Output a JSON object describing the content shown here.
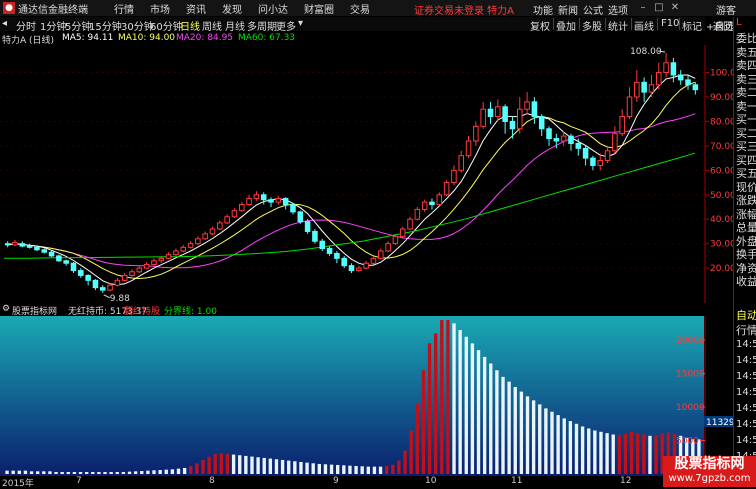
{
  "titlebar": {
    "app_name": "通达信金融终端",
    "menus": [
      "行情",
      "市场",
      "资讯",
      "发现",
      "问小达",
      "财富圈",
      "交易"
    ],
    "warning": "证券交易未登录 特力A",
    "right_menus": [
      "功能",
      "新闻",
      "公式",
      "选项"
    ],
    "guest": "游客"
  },
  "toolbar": {
    "periods": [
      "分时",
      "1分钟",
      "5分钟",
      "15分钟",
      "30分钟",
      "60分钟",
      "日线",
      "周线",
      "月线",
      "多周期",
      "更多"
    ],
    "active_period": "日线",
    "right_tools": [
      "复权",
      "叠加",
      "多股",
      "统计",
      "画线",
      "F10",
      "标记",
      "+自选",
      "返回"
    ]
  },
  "infobar": {
    "stock": "特力A (日线)",
    "ma5": "MA5: 94.11",
    "ma10": "MA10: 94.00",
    "ma20": "MA20: 84.95",
    "ma60": "MA60: 67.33"
  },
  "colors": {
    "ma5": "#ffffff",
    "ma10": "#ffff54",
    "ma20": "#ff40ff",
    "ma60": "#00e000",
    "up": "#ff3b3b",
    "down": "#54ffff",
    "accent": "#ffff54"
  },
  "price_axis": {
    "labels": [
      "100.00",
      "90.00",
      "80.00",
      "70.00",
      "60.00",
      "50.00",
      "40.00",
      "30.00",
      "20.00"
    ],
    "values": [
      100,
      90,
      80,
      70,
      60,
      50,
      40,
      30,
      20
    ],
    "min": 9,
    "max": 108
  },
  "annotations": {
    "high": "108.00",
    "low": "9.88",
    "corner_l": "L"
  },
  "right_panel": {
    "items": [
      "委比",
      "卖五",
      "卖四",
      "卖三",
      "卖二",
      "卖一",
      "买一",
      "买二",
      "买三",
      "买四",
      "买五",
      "现价",
      "涨跌",
      "涨幅",
      "总量",
      "外盘",
      "换手",
      "净资",
      "收益"
    ],
    "lower_items": [
      "自动",
      "行情"
    ],
    "times": [
      "14:50",
      "14:50",
      "14:50",
      "14:50",
      "14:50",
      "14:50",
      "14:50",
      "14:50"
    ]
  },
  "indicator": {
    "title": "股票指标网",
    "label": "无红持币: 5173.37",
    "label2": "翻红持股",
    "label3": "分界线: 1.00",
    "axis_labels": [
      "20000",
      "15000",
      "10000",
      "5000"
    ],
    "axis_values": [
      20000,
      15000,
      10000,
      5000
    ],
    "current": "11329.5",
    "max": 23000
  },
  "dates": {
    "labels": [
      "2015年",
      "7",
      "8",
      "9",
      "10",
      "11",
      "12"
    ]
  },
  "watermark": {
    "line1": "股票指标网",
    "line2": "www.7gpzb.com"
  },
  "chart_data": {
    "type": "candlestick",
    "x_labels": [
      "2015年",
      "7",
      "8",
      "9",
      "10",
      "11",
      "12"
    ],
    "ylim": [
      9,
      108
    ],
    "candles": [
      {
        "o": 30,
        "c": 29.5,
        "h": 31,
        "l": 28.5
      },
      {
        "o": 29.5,
        "c": 30.5,
        "h": 31.5,
        "l": 29
      },
      {
        "o": 30,
        "c": 29,
        "h": 31,
        "l": 28.5
      },
      {
        "o": 29,
        "c": 28.5,
        "h": 30,
        "l": 28
      },
      {
        "o": 28.5,
        "c": 27.5,
        "h": 29,
        "l": 27
      },
      {
        "o": 27.5,
        "c": 26.5,
        "h": 28,
        "l": 26
      },
      {
        "o": 26.5,
        "c": 25,
        "h": 27,
        "l": 24.5
      },
      {
        "o": 25,
        "c": 23,
        "h": 25.5,
        "l": 22.5
      },
      {
        "o": 23,
        "c": 22,
        "h": 23.5,
        "l": 21
      },
      {
        "o": 22,
        "c": 19,
        "h": 22.5,
        "l": 18
      },
      {
        "o": 19,
        "c": 17,
        "h": 20,
        "l": 16
      },
      {
        "o": 17,
        "c": 15,
        "h": 17.5,
        "l": 13
      },
      {
        "o": 15,
        "c": 12,
        "h": 15.5,
        "l": 11
      },
      {
        "o": 12,
        "c": 11,
        "h": 13,
        "l": 9.88
      },
      {
        "o": 11,
        "c": 13,
        "h": 14,
        "l": 10.5
      },
      {
        "o": 13,
        "c": 15,
        "h": 16,
        "l": 12.5
      },
      {
        "o": 15,
        "c": 17,
        "h": 18,
        "l": 14.5
      },
      {
        "o": 17,
        "c": 18.5,
        "h": 19.5,
        "l": 16.5
      },
      {
        "o": 18.5,
        "c": 20,
        "h": 21,
        "l": 18
      },
      {
        "o": 20,
        "c": 21.5,
        "h": 22.5,
        "l": 19.5
      },
      {
        "o": 21.5,
        "c": 23,
        "h": 24,
        "l": 21
      },
      {
        "o": 23,
        "c": 24,
        "h": 25,
        "l": 22
      },
      {
        "o": 24,
        "c": 25.5,
        "h": 26.5,
        "l": 23.5
      },
      {
        "o": 25.5,
        "c": 27,
        "h": 28,
        "l": 25
      },
      {
        "o": 27,
        "c": 28.5,
        "h": 29.5,
        "l": 26.5
      },
      {
        "o": 28.5,
        "c": 30,
        "h": 31,
        "l": 28
      },
      {
        "o": 30,
        "c": 32,
        "h": 33,
        "l": 29.5
      },
      {
        "o": 32,
        "c": 34,
        "h": 35,
        "l": 31.5
      },
      {
        "o": 34,
        "c": 36,
        "h": 37,
        "l": 33.5
      },
      {
        "o": 36,
        "c": 38.5,
        "h": 39.5,
        "l": 35.5
      },
      {
        "o": 38.5,
        "c": 41,
        "h": 42,
        "l": 38
      },
      {
        "o": 41,
        "c": 43.5,
        "h": 44.5,
        "l": 40.5
      },
      {
        "o": 43.5,
        "c": 46,
        "h": 47,
        "l": 43
      },
      {
        "o": 46,
        "c": 48.5,
        "h": 50,
        "l": 45.5
      },
      {
        "o": 48.5,
        "c": 50,
        "h": 51.5,
        "l": 47.5
      },
      {
        "o": 50,
        "c": 48,
        "h": 51,
        "l": 46
      },
      {
        "o": 48,
        "c": 47,
        "h": 49,
        "l": 45
      },
      {
        "o": 47,
        "c": 48.5,
        "h": 49.5,
        "l": 46
      },
      {
        "o": 48.5,
        "c": 46,
        "h": 49,
        "l": 44
      },
      {
        "o": 46,
        "c": 43,
        "h": 46.5,
        "l": 42
      },
      {
        "o": 43,
        "c": 39,
        "h": 43.5,
        "l": 38
      },
      {
        "o": 39,
        "c": 35,
        "h": 40,
        "l": 34
      },
      {
        "o": 35,
        "c": 31,
        "h": 36,
        "l": 30
      },
      {
        "o": 31,
        "c": 28,
        "h": 32,
        "l": 27
      },
      {
        "o": 28,
        "c": 26,
        "h": 29,
        "l": 25
      },
      {
        "o": 26,
        "c": 24,
        "h": 27,
        "l": 22
      },
      {
        "o": 24,
        "c": 21,
        "h": 25,
        "l": 20
      },
      {
        "o": 21,
        "c": 19,
        "h": 22,
        "l": 18
      },
      {
        "o": 19,
        "c": 20,
        "h": 21,
        "l": 18.5
      },
      {
        "o": 20,
        "c": 22,
        "h": 23,
        "l": 19.5
      },
      {
        "o": 22,
        "c": 24,
        "h": 25,
        "l": 21.5
      },
      {
        "o": 24,
        "c": 27,
        "h": 28,
        "l": 23.5
      },
      {
        "o": 27,
        "c": 30,
        "h": 31,
        "l": 26.5
      },
      {
        "o": 30,
        "c": 33,
        "h": 34,
        "l": 29.5
      },
      {
        "o": 33,
        "c": 36,
        "h": 37,
        "l": 32.5
      },
      {
        "o": 36,
        "c": 40,
        "h": 41,
        "l": 35.5
      },
      {
        "o": 40,
        "c": 44,
        "h": 45,
        "l": 39.5
      },
      {
        "o": 44,
        "c": 47,
        "h": 48,
        "l": 43
      },
      {
        "o": 47,
        "c": 46,
        "h": 48.5,
        "l": 44
      },
      {
        "o": 46,
        "c": 50,
        "h": 51,
        "l": 45.5
      },
      {
        "o": 50,
        "c": 55,
        "h": 56,
        "l": 49.5
      },
      {
        "o": 55,
        "c": 60,
        "h": 62,
        "l": 54
      },
      {
        "o": 60,
        "c": 66,
        "h": 68,
        "l": 59
      },
      {
        "o": 66,
        "c": 72,
        "h": 74,
        "l": 65
      },
      {
        "o": 72,
        "c": 78,
        "h": 80,
        "l": 70
      },
      {
        "o": 78,
        "c": 85,
        "h": 88,
        "l": 77
      },
      {
        "o": 85,
        "c": 82,
        "h": 88,
        "l": 79
      },
      {
        "o": 82,
        "c": 86,
        "h": 89,
        "l": 80
      },
      {
        "o": 86,
        "c": 80,
        "h": 87,
        "l": 75
      },
      {
        "o": 80,
        "c": 77,
        "h": 82,
        "l": 73
      },
      {
        "o": 77,
        "c": 85,
        "h": 90,
        "l": 75
      },
      {
        "o": 85,
        "c": 88,
        "h": 92,
        "l": 83
      },
      {
        "o": 88,
        "c": 82,
        "h": 90,
        "l": 79
      },
      {
        "o": 82,
        "c": 77,
        "h": 83,
        "l": 74
      },
      {
        "o": 77,
        "c": 73,
        "h": 78,
        "l": 70
      },
      {
        "o": 73,
        "c": 72,
        "h": 75,
        "l": 69
      },
      {
        "o": 72,
        "c": 74,
        "h": 76,
        "l": 70
      },
      {
        "o": 74,
        "c": 71,
        "h": 75,
        "l": 68
      },
      {
        "o": 71,
        "c": 69,
        "h": 73,
        "l": 66
      },
      {
        "o": 69,
        "c": 65,
        "h": 70,
        "l": 62
      },
      {
        "o": 65,
        "c": 62,
        "h": 66,
        "l": 60
      },
      {
        "o": 62,
        "c": 64,
        "h": 67,
        "l": 60
      },
      {
        "o": 64,
        "c": 68,
        "h": 70,
        "l": 63
      },
      {
        "o": 68,
        "c": 75,
        "h": 78,
        "l": 67
      },
      {
        "o": 75,
        "c": 82,
        "h": 85,
        "l": 74
      },
      {
        "o": 82,
        "c": 90,
        "h": 94,
        "l": 81
      },
      {
        "o": 90,
        "c": 96,
        "h": 101,
        "l": 88
      },
      {
        "o": 96,
        "c": 92,
        "h": 98,
        "l": 88
      },
      {
        "o": 92,
        "c": 95,
        "h": 99,
        "l": 90
      },
      {
        "o": 95,
        "c": 100,
        "h": 104,
        "l": 93
      },
      {
        "o": 100,
        "c": 104,
        "h": 108,
        "l": 98
      },
      {
        "o": 104,
        "c": 99,
        "h": 106,
        "l": 96
      },
      {
        "o": 99,
        "c": 97,
        "h": 101,
        "l": 95
      },
      {
        "o": 97,
        "c": 95,
        "h": 99,
        "l": 93
      },
      {
        "o": 95,
        "c": 93,
        "h": 96,
        "l": 91
      }
    ],
    "ma_window": {
      "ma5": 5,
      "ma10": 10,
      "ma20": 20
    },
    "ma60_points": [
      24,
      24,
      24.2,
      24.3,
      24.4,
      24.5,
      24.6,
      24.7,
      25,
      25.5,
      26,
      26.8,
      28,
      29.5,
      31,
      33,
      35,
      37.5,
      40,
      43,
      46,
      49,
      52,
      55,
      58,
      61,
      64,
      67
    ]
  },
  "indicator_data": {
    "type": "bar",
    "values": [
      500,
      500,
      500,
      500,
      400,
      400,
      400,
      400,
      300,
      300,
      300,
      300,
      300,
      300,
      300,
      300,
      300,
      300,
      300,
      300,
      350,
      400,
      450,
      500,
      550,
      600,
      650,
      700,
      800,
      900,
      1200,
      1600,
      2100,
      2600,
      3000,
      3100,
      3000,
      2900,
      2800,
      2700,
      2600,
      2500,
      2400,
      2300,
      2200,
      2100,
      2000,
      1900,
      1800,
      1700,
      1600,
      1500,
      1450,
      1400,
      1350,
      1300,
      1250,
      1200,
      1150,
      1100,
      1100,
      1100,
      1200,
      1400,
      2000,
      3500,
      6500,
      10500,
      15500,
      19500,
      21000,
      23000,
      23000,
      22500,
      21500,
      20500,
      19500,
      18500,
      17500,
      16500,
      15500,
      14500,
      13800,
      13000,
      12300,
      11600,
      11000,
      10400,
      9800,
      9300,
      8800,
      8300,
      7900,
      7500,
      7100,
      6800,
      6500,
      6300,
      6100,
      5900,
      5800,
      6000,
      6300,
      6100,
      5900,
      5700,
      5800,
      6100,
      6200,
      6000,
      5700,
      5400,
      5200,
      5173
    ],
    "red_ranges": [
      [
        30,
        36
      ],
      [
        62,
        72
      ],
      [
        100,
        104
      ],
      [
        106,
        109
      ]
    ],
    "ylim": [
      0,
      23000
    ]
  }
}
